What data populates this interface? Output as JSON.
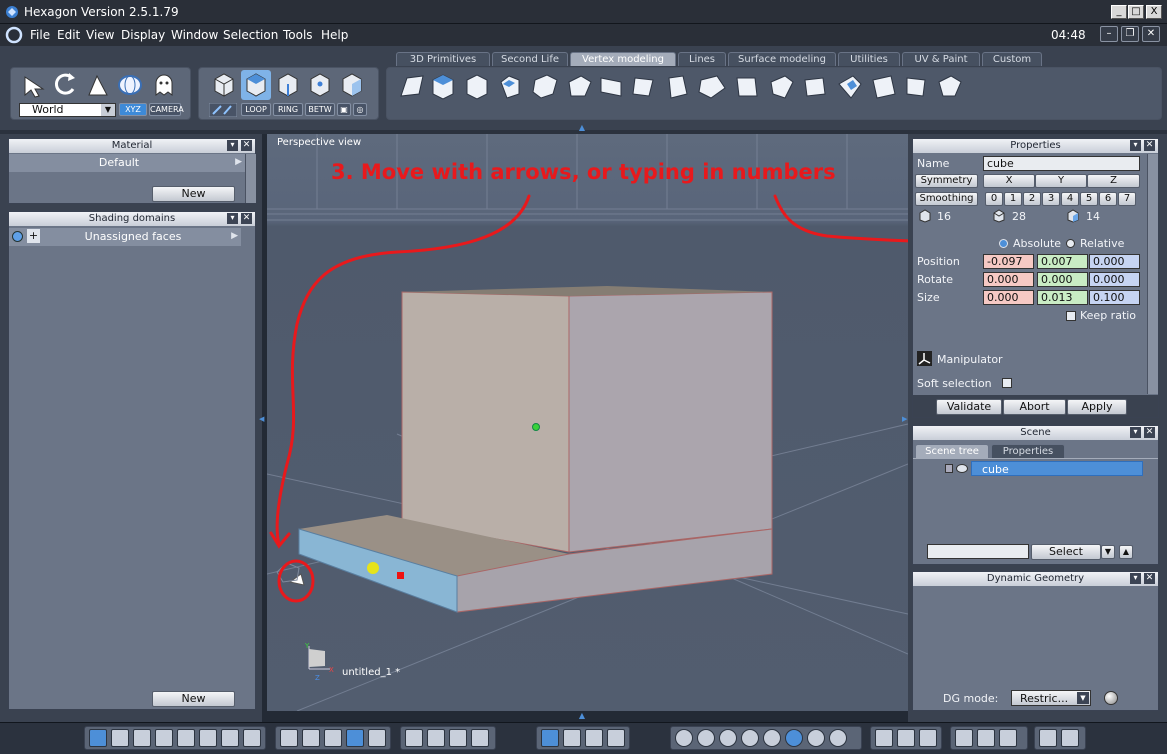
{
  "window": {
    "title": "Hexagon Version 2.5.1.79",
    "min": "_",
    "max": "□",
    "close": "X"
  },
  "menu": {
    "items": [
      "File",
      "Edit",
      "View",
      "Display",
      "Window",
      "Selection",
      "Tools",
      "Help"
    ],
    "clock": "04:48",
    "min": "–",
    "restore": "❐",
    "close": "✕"
  },
  "tabs": [
    "3D Primitives",
    "Second Life",
    "Vertex modeling",
    "Lines",
    "Surface modeling",
    "Utilities",
    "UV & Paint",
    "Custom"
  ],
  "left_tools": {
    "coord_label": "World",
    "xyz": "XYZ",
    "camera": "CAMERA"
  },
  "sel_tools": {
    "loop": "LOOP",
    "ring": "RING",
    "betw": "BETW"
  },
  "material": {
    "title": "Material",
    "value": "Default",
    "new_label": "New"
  },
  "shading": {
    "title": "Shading domains",
    "row": "Unassigned faces",
    "new_label": "New"
  },
  "viewport": {
    "label": "Perspective view",
    "annotation": "3. Move with arrows, or typing in numbers",
    "doc": "untitled_1 *",
    "axis_x": "X",
    "axis_y": "Y",
    "axis_z": "Z"
  },
  "properties": {
    "title": "Properties",
    "name_label": "Name",
    "name_value": "cube",
    "symmetry": "Symmetry",
    "sym_axes": [
      "X",
      "Y",
      "Z"
    ],
    "smoothing": "Smoothing",
    "smooth_levels": [
      "0",
      "1",
      "2",
      "3",
      "4",
      "5",
      "6",
      "7"
    ],
    "counts": [
      "16",
      "28",
      "14"
    ],
    "absolute": "Absolute",
    "relative": "Relative",
    "position_label": "Position",
    "position": [
      "-0.097",
      "0.007",
      "0.000"
    ],
    "rotate_label": "Rotate",
    "rotate": [
      "0.000",
      "0.000",
      "0.000"
    ],
    "size_label": "Size",
    "size": [
      "0.000",
      "0.013",
      "0.100"
    ],
    "keep_ratio": "Keep ratio",
    "manipulator": "Manipulator",
    "soft_selection": "Soft selection",
    "validate": "Validate",
    "abort": "Abort",
    "apply": "Apply"
  },
  "scene": {
    "title": "Scene",
    "tab_tree": "Scene tree",
    "tab_props": "Properties",
    "item": "cube",
    "select": "Select"
  },
  "dyngeo": {
    "title": "Dynamic Geometry",
    "mode_label": "DG mode:",
    "mode_value": "Restric..."
  },
  "colors": {
    "accent": "#4d8fd8",
    "annotation": "#e8191c",
    "position_x_bg": "#f6c9c4",
    "position_y_bg": "#c9ecc4",
    "position_z_bg": "#c6d4f2"
  }
}
